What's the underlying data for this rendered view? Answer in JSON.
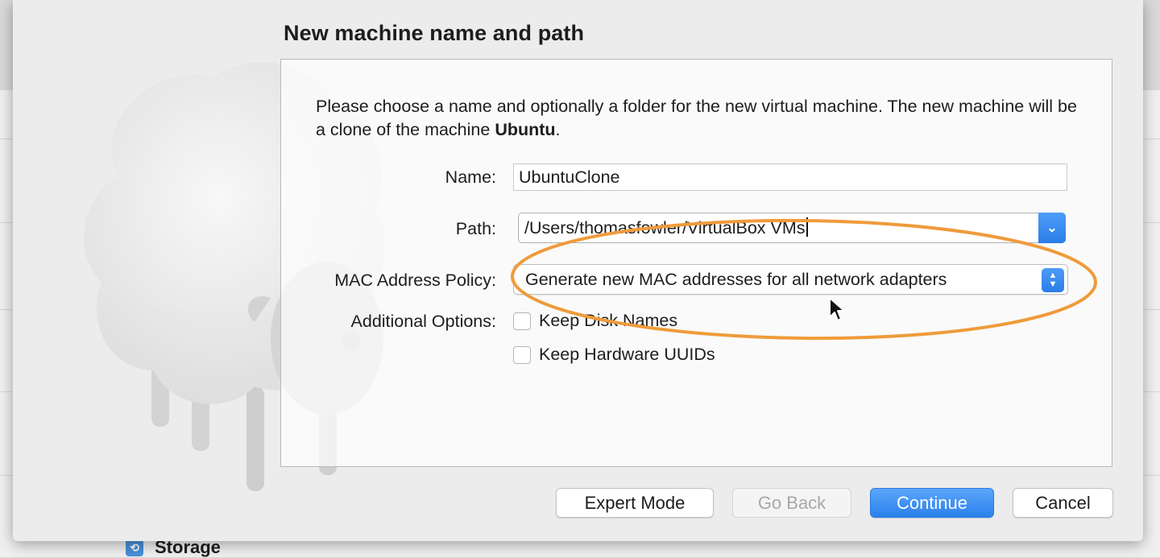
{
  "page": {
    "title": "New machine name and path",
    "description_prefix": "Please choose a name and optionally a folder for the new virtual machine. The new machine will be a clone of the machine ",
    "description_machine": "Ubuntu",
    "description_suffix": "."
  },
  "form": {
    "name_label": "Name:",
    "name_value": "UbuntuClone",
    "path_label": "Path:",
    "path_value": "/Users/thomasfowler/VirtualBox VMs",
    "mac_label": "MAC Address Policy:",
    "mac_value": "Generate new MAC addresses for all network adapters",
    "additional_label": "Additional Options:",
    "options": [
      {
        "label": "Keep Disk Names",
        "checked": false
      },
      {
        "label": "Keep Hardware UUIDs",
        "checked": false
      }
    ]
  },
  "buttons": {
    "expert": "Expert Mode",
    "back": "Go Back",
    "continue": "Continue",
    "cancel": "Cancel"
  },
  "background": {
    "storage_label": "Storage"
  },
  "colors": {
    "accent": "#2b81ec",
    "highlight": "#ef9b3b"
  }
}
